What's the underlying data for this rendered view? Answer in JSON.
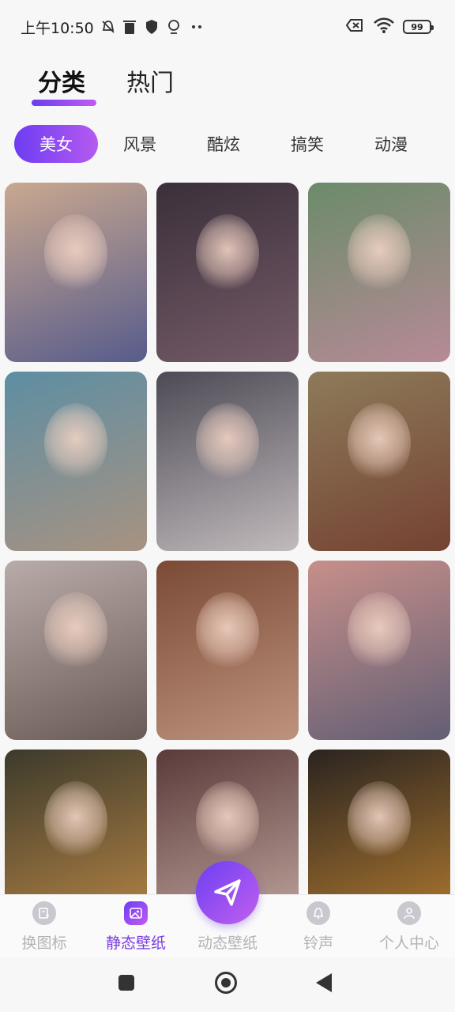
{
  "status_bar": {
    "time": "上午10:50",
    "icons": [
      "mute-icon",
      "trash-icon",
      "shield-icon",
      "location-icon",
      "more-icon"
    ],
    "right_icons": [
      "sim-off-icon",
      "wifi-icon",
      "battery-icon"
    ],
    "battery": "99"
  },
  "top_tabs": [
    {
      "label": "分类",
      "active": true
    },
    {
      "label": "热门",
      "active": false
    }
  ],
  "categories": [
    {
      "label": "美女",
      "active": true
    },
    {
      "label": "风景",
      "active": false
    },
    {
      "label": "酷炫",
      "active": false
    },
    {
      "label": "搞笑",
      "active": false
    },
    {
      "label": "动漫",
      "active": false
    }
  ],
  "wallpapers": [
    {
      "bg": "#c9a88f",
      "accent": "#2a3d8a"
    },
    {
      "bg": "#3a2f3a",
      "accent": "#8c6d7a"
    },
    {
      "bg": "#6b8b6a",
      "accent": "#d58aa8"
    },
    {
      "bg": "#5d8ea3",
      "accent": "#c59474"
    },
    {
      "bg": "#4d4a55",
      "accent": "#f0e8e6"
    },
    {
      "bg": "#8d7b5a",
      "accent": "#6b2b22"
    },
    {
      "bg": "#b9aba8",
      "accent": "#4a3a35"
    },
    {
      "bg": "#7a4a35",
      "accent": "#d9b09a"
    },
    {
      "bg": "#c78f8a",
      "accent": "#3a4b6b"
    },
    {
      "bg": "#3c3a2c",
      "accent": "#e6a24e"
    },
    {
      "bg": "#5a3a3a",
      "accent": "#e9d0c5"
    },
    {
      "bg": "#2a2420",
      "accent": "#e59b35"
    }
  ],
  "bottom_nav": [
    {
      "label": "换图标",
      "icon": "image-edit-icon",
      "active": false
    },
    {
      "label": "静态壁纸",
      "icon": "picture-icon",
      "active": true
    },
    {
      "label": "动态壁纸",
      "icon": "send-icon",
      "active": false
    },
    {
      "label": "铃声",
      "icon": "bell-icon",
      "active": false
    },
    {
      "label": "个人中心",
      "icon": "user-icon",
      "active": false
    }
  ],
  "colors": {
    "accent_start": "#6d3df3",
    "accent_end": "#c25bef"
  }
}
